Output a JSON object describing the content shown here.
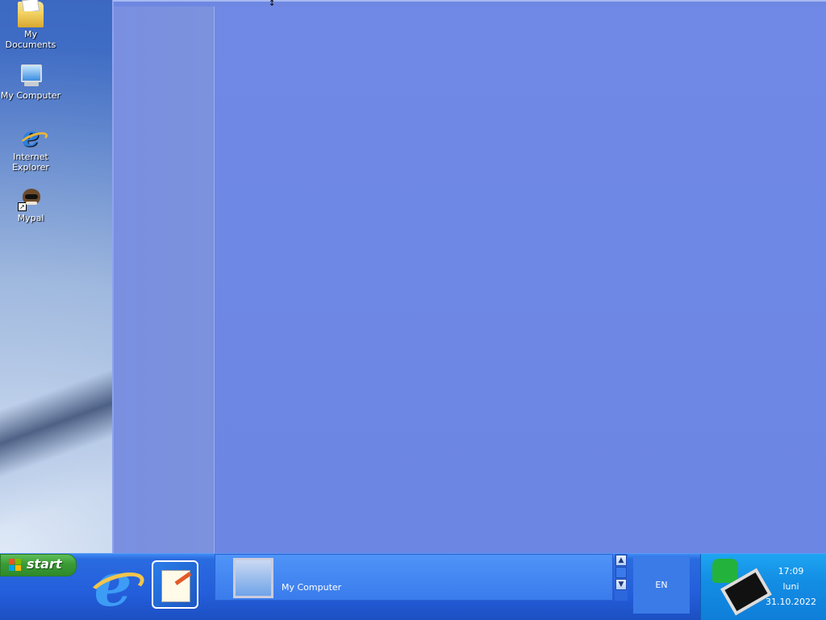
{
  "desktop": {
    "icons": [
      {
        "label": "My Documents",
        "icon": "folder-documents-icon"
      },
      {
        "label": "My Computer",
        "icon": "computer-icon"
      },
      {
        "label": "Internet Explorer",
        "icon": "internet-explorer-icon"
      },
      {
        "label": "Mypal",
        "icon": "mypal-icon",
        "shortcut": true
      }
    ]
  },
  "taskbar": {
    "start_label": "start",
    "quick_launch": [
      {
        "icon": "internet-explorer-icon"
      },
      {
        "icon": "notepad-icon"
      }
    ],
    "tasks": [
      {
        "label": "My Computer",
        "icon": "computer-icon"
      }
    ],
    "language": "EN",
    "clock": {
      "time": "17:09",
      "day": "luni",
      "date": "31.10.2022"
    }
  },
  "colors": {
    "taskbar": "#245edb",
    "start_button": "#3a9a34",
    "tray": "#138ee5",
    "window_fill": "#6e87e2"
  }
}
